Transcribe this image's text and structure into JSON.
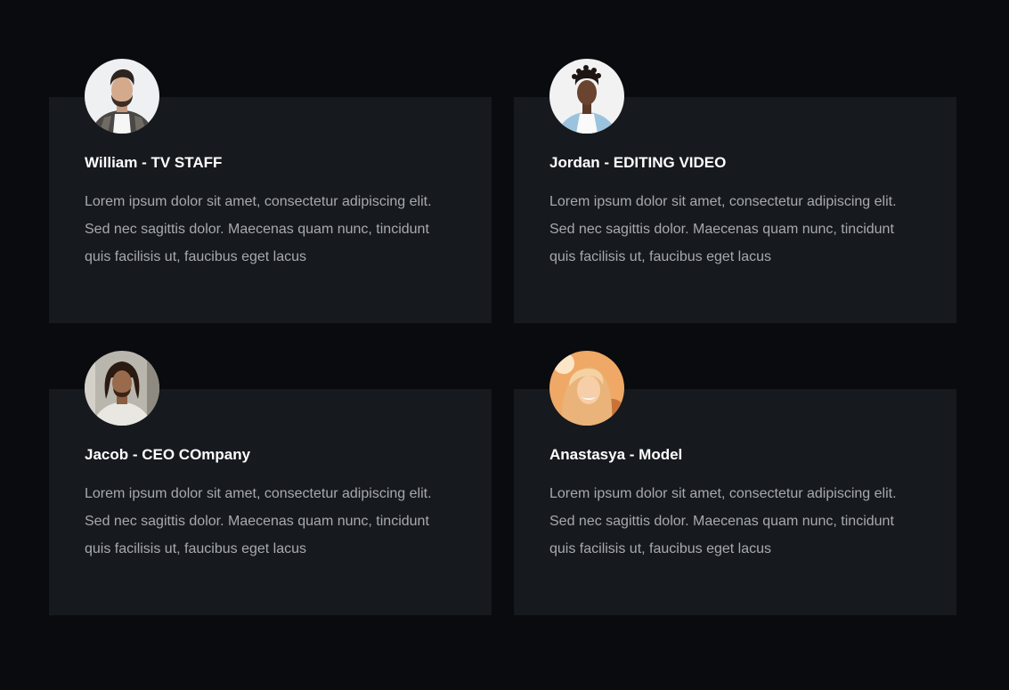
{
  "theme": {
    "background": "#0a0b0f",
    "card_background": "#16191d",
    "title_color": "#ffffff",
    "text_color": "#a7a9ad"
  },
  "cards": [
    {
      "name": "William - TV STAFF",
      "avatar": "william-avatar",
      "text_lines": [
        "Lorem ipsum dolor sit amet, consectetur adipiscing elit.",
        "Sed nec sagittis dolor. Maecenas quam nunc, tincidunt",
        "quis facilisis ut, faucibus eget lacus"
      ]
    },
    {
      "name": "Jordan - EDITING VIDEO",
      "avatar": "jordan-avatar",
      "text_lines": [
        "Lorem ipsum dolor sit amet, consectetur adipiscing elit.",
        "Sed nec sagittis dolor. Maecenas quam nunc, tincidunt",
        "quis facilisis ut, faucibus eget lacus"
      ]
    },
    {
      "name": "Jacob - CEO COmpany",
      "avatar": "jacob-avatar",
      "text_lines": [
        "Lorem ipsum dolor sit amet, consectetur adipiscing elit.",
        "Sed nec sagittis dolor. Maecenas quam nunc, tincidunt",
        "quis facilisis ut, faucibus eget lacus"
      ]
    },
    {
      "name": "Anastasya - Model",
      "avatar": "anastasya-avatar",
      "text_lines": [
        "Lorem ipsum dolor sit amet, consectetur adipiscing elit.",
        "Sed nec sagittis dolor. Maecenas quam nunc, tincidunt",
        "quis facilisis ut, faucibus eget lacus"
      ]
    }
  ]
}
